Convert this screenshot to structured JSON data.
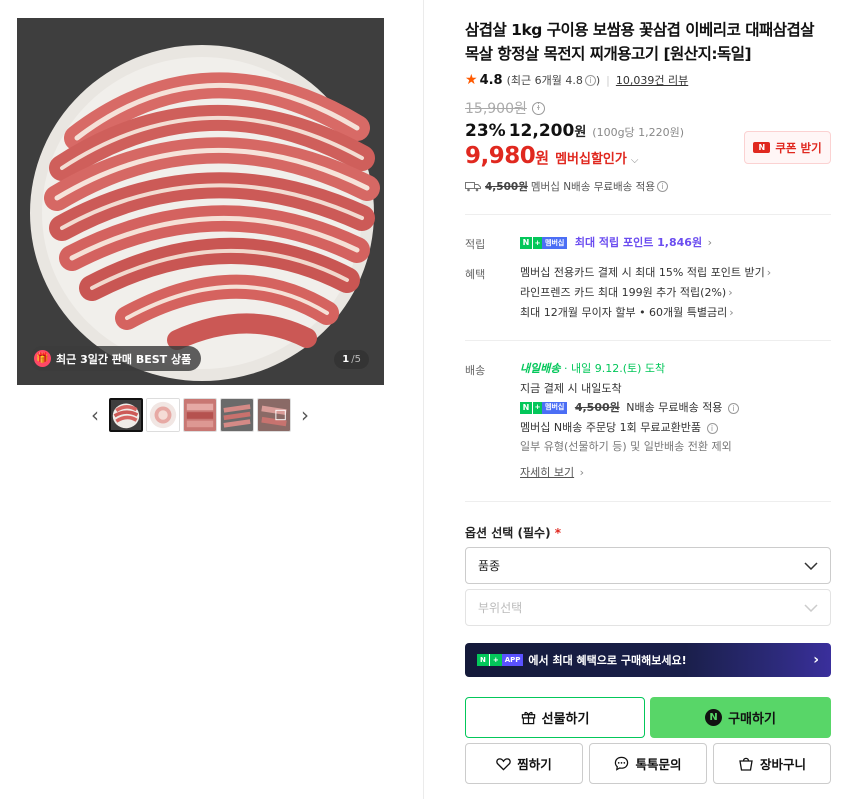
{
  "gallery": {
    "badge_text": "최근 3일간 판매 BEST 상품",
    "counter_current": "1",
    "counter_total": "/5",
    "prev_arrow": "‹",
    "next_arrow": "›",
    "thumbnail_count": 5,
    "selected_thumbnail": 1
  },
  "product": {
    "title": "삼겹살 1kg 구이용 보쌈용 꽃삼겹 이베리코 대패삼겹살 목살 항정살 목전지 찌개용고기 [원산지:독일]",
    "rating_score": "4.8",
    "rating_recent": "(최근 6개월 4.8",
    "rating_recent_close": ")",
    "review_count": "10,039건 리뷰",
    "original_price": "15,900원",
    "discount_rate": "23%",
    "sale_price": "12,200",
    "sale_won": "원",
    "unit_price": "(100g당 1,220원)",
    "member_price": "9,980",
    "member_won": "원",
    "member_label": "멤버십할인가",
    "coupon_label": "쿠폰 받기",
    "coupon_icon_text": "N",
    "shipping_fee": "4,500원",
    "shipping_text": "멤버십 N배송 무료배송 적용"
  },
  "benefits": {
    "points_label": "적립",
    "points_text": "최대 적립 포인트 1,846원",
    "benefit_label": "혜택",
    "benefit_lines": [
      "멤버십 전용카드 결제 시 최대 15% 적립 포인트 받기",
      "라인프렌즈 카드 최대 199원 추가 적립(2%)",
      "최대 12개월 무이자 할부 • 60개월 특별금리"
    ]
  },
  "delivery": {
    "label": "배송",
    "tomorrow_label": "내일배송",
    "arrival": "· 내일 9.12.(토) 도착",
    "pay_note": "지금 결제 시 내일도착",
    "fee_strike": "4,500원",
    "fee_text": "N배송 무료배송 적용",
    "exchange_note": "멤버십 N배송 주문당 1회 무료교환반품",
    "exception_note": "일부 유형(선물하기 등) 및 일반배송 전환 제외",
    "detail_link": "자세히 보기"
  },
  "badges": {
    "n": "N",
    "plus": "+",
    "membership": "멤버십",
    "app": "APP"
  },
  "options": {
    "title": "옵션 선택 (필수)",
    "required_mark": "*",
    "select1_value": "품종",
    "select2_placeholder": "부위선택"
  },
  "app_banner": {
    "text": "에서 최대 혜택으로 구매해보세요!"
  },
  "buttons": {
    "gift": "선물하기",
    "buy": "구매하기",
    "wish": "찜하기",
    "talk": "톡톡문의",
    "cart": "장바구니"
  },
  "colors": {
    "accent_red": "#e0281f",
    "naver_green": "#03c75a",
    "buy_green": "#58d668",
    "point_purple": "#6b4df0"
  }
}
